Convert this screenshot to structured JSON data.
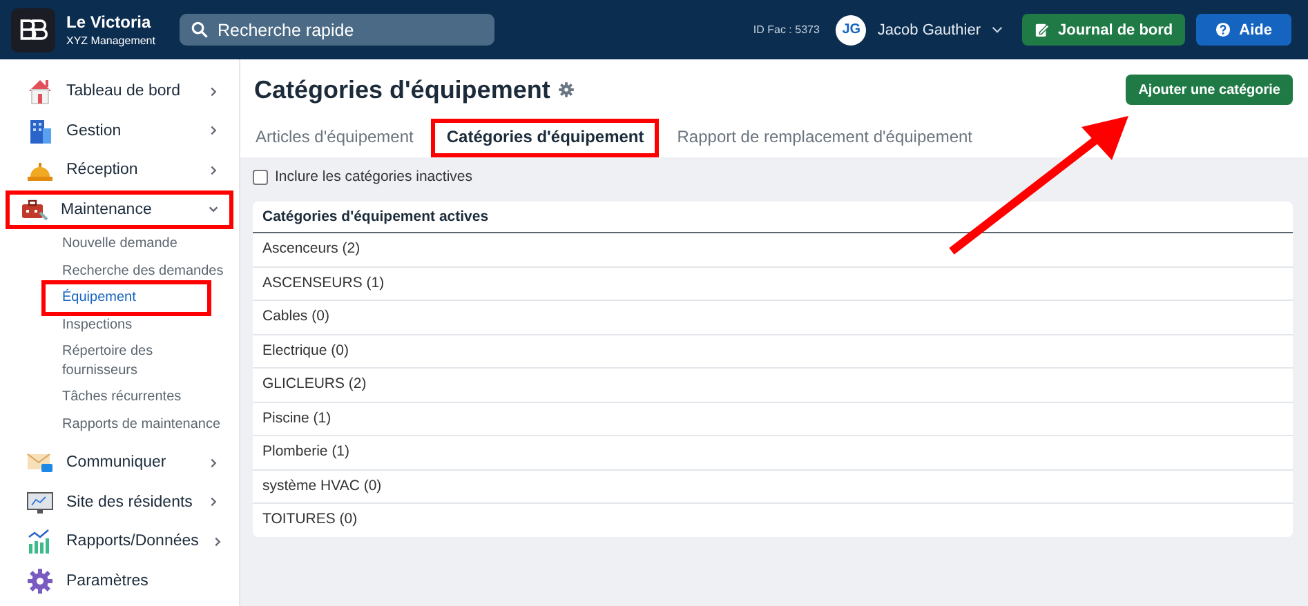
{
  "header": {
    "property": "Le Victoria",
    "company": "XYZ Management",
    "search": {
      "placeholder": "Recherche rapide"
    },
    "id_fac": "ID Fac : 5373",
    "user": {
      "initials": "JG",
      "name": "Jacob Gauthier"
    },
    "buttons": [
      {
        "label": "Journal de bord",
        "kind": "journal"
      },
      {
        "label": "Aide",
        "kind": "help"
      }
    ]
  },
  "sidebar": {
    "items": [
      {
        "label": "Tableau de bord",
        "expanded": false,
        "highlighted": false
      },
      {
        "label": "Gestion",
        "expanded": false,
        "highlighted": false
      },
      {
        "label": "Réception",
        "expanded": false,
        "highlighted": false
      },
      {
        "label": "Maintenance",
        "expanded": true,
        "highlighted": true,
        "children": [
          {
            "label": "Nouvelle demande",
            "selected": false,
            "highlighted": false
          },
          {
            "label": "Recherche des demandes",
            "selected": false,
            "highlighted": false
          },
          {
            "label": "Équipement",
            "selected": true,
            "highlighted": true
          },
          {
            "label": "Inspections",
            "selected": false,
            "highlighted": false
          },
          {
            "label": "Répertoire des fournisseurs",
            "selected": false,
            "highlighted": false
          },
          {
            "label": "Tâches récurrentes",
            "selected": false,
            "highlighted": false
          },
          {
            "label": "Rapports de maintenance",
            "selected": false,
            "highlighted": false
          }
        ]
      },
      {
        "label": "Communiquer",
        "expanded": false,
        "highlighted": false
      },
      {
        "label": "Site des résidents",
        "expanded": false,
        "highlighted": false
      },
      {
        "label": "Rapports/Données",
        "expanded": false,
        "highlighted": false
      },
      {
        "label": "Paramètres",
        "highlighted": false
      }
    ]
  },
  "page": {
    "title": "Catégories d'équipement",
    "add_button": {
      "label": "Ajouter une catégorie",
      "pointed_at": true
    },
    "tabs": [
      {
        "label": "Articles d'équipement",
        "selected": false,
        "highlighted": false
      },
      {
        "label": "Catégories d'équipement",
        "selected": true,
        "highlighted": true
      },
      {
        "label": "Rapport de remplacement d'équipement",
        "selected": false,
        "highlighted": false
      }
    ],
    "include_inactive": {
      "label": "Inclure les catégories inactives",
      "checked": false
    },
    "table": {
      "heading": "Catégories d'équipement actives",
      "rows": [
        "Ascenceurs (2)",
        "ASCENSEURS (1)",
        "Cables (0)",
        "Electrique (0)",
        "GLICLEURS (2)",
        "Piscine (1)",
        "Plomberie (1)",
        "système HVAC (0)",
        "TOITURES (0)"
      ]
    }
  }
}
